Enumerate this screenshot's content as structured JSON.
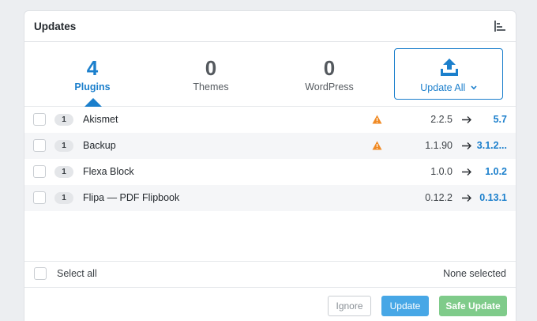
{
  "header": {
    "title": "Updates",
    "icon": "filter-list-icon"
  },
  "tabs": [
    {
      "count": "4",
      "label": "Plugins",
      "active": true
    },
    {
      "count": "0",
      "label": "Themes",
      "active": false
    },
    {
      "count": "0",
      "label": "WordPress",
      "active": false
    }
  ],
  "update_all": {
    "label": "Update All",
    "icon": "upload-icon"
  },
  "rows": [
    {
      "badge": "1",
      "name": "Akismet",
      "warning": true,
      "from": "2.2.5",
      "to": "5.7"
    },
    {
      "badge": "1",
      "name": "Backup",
      "warning": true,
      "from": "1.1.90",
      "to": "3.1.2..."
    },
    {
      "badge": "1",
      "name": "Flexa Block",
      "warning": false,
      "from": "1.0.0",
      "to": "1.0.2"
    },
    {
      "badge": "1",
      "name": "Flipa — PDF Flipbook",
      "warning": false,
      "from": "0.12.2",
      "to": "0.13.1"
    }
  ],
  "footer": {
    "select_all_label": "Select all",
    "selection_status": "None selected"
  },
  "actions": {
    "ignore_label": "Ignore",
    "update_label": "Update",
    "safe_update_label": "Safe Update"
  },
  "colors": {
    "accent": "#1b7fcc",
    "warning": "#f08a24",
    "update": "#47a7e6",
    "safe_update": "#7fcb8a"
  }
}
